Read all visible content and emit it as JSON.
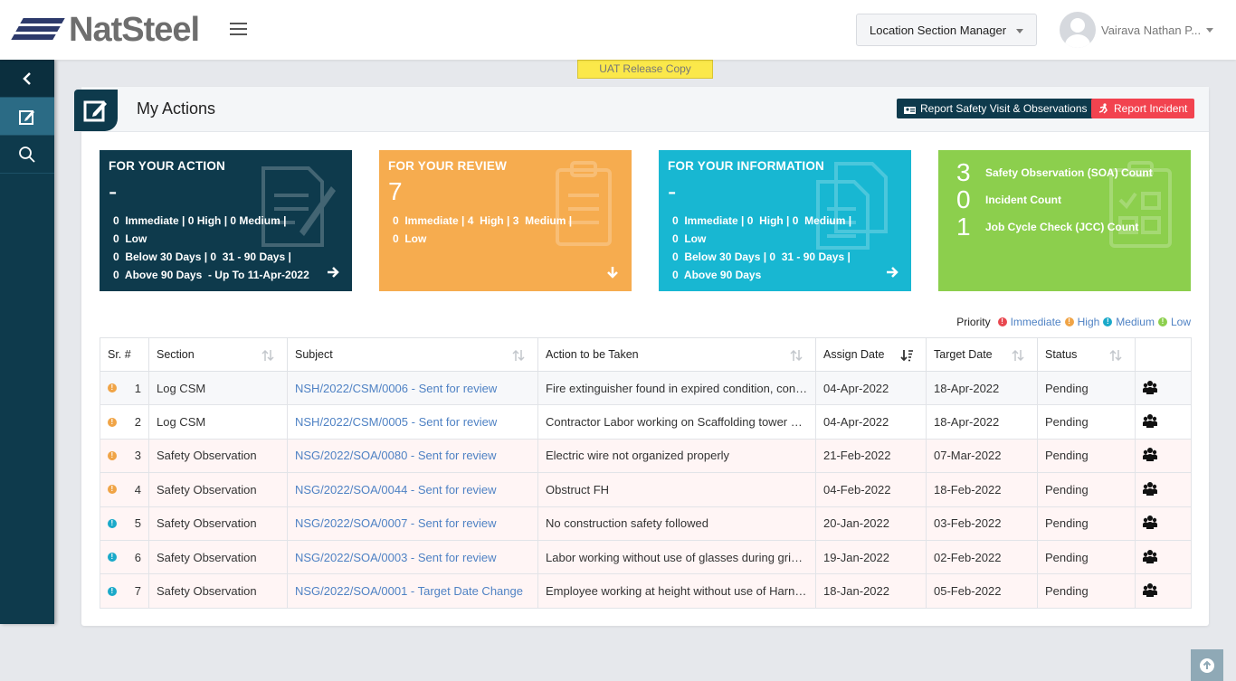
{
  "header": {
    "brand": "NatSteel",
    "role": "Location Section Manager",
    "user_name": "Vairava Nathan P..."
  },
  "banner": "UAT Release Copy",
  "panel": {
    "title": "My Actions",
    "btn_report_visit": "Report Safety Visit & Observations",
    "btn_report_incident": "Report Incident"
  },
  "cards": {
    "action": {
      "title": "FOR YOUR ACTION",
      "big": "-",
      "line1": "0  Immediate | 0 High | 0 Medium |",
      "line2": "0  Low",
      "line3": "0  Below 30 Days | 0  31 - 90 Days |",
      "line4": "0  Above 90 Days  - Up To 11-Apr-2022"
    },
    "review": {
      "title": "FOR YOUR REVIEW",
      "big": "7",
      "line1": "0  Immediate | 4  High | 3  Medium |",
      "line2": "0  Low"
    },
    "info": {
      "title": "FOR YOUR INFORMATION",
      "big": "-",
      "line1": "0  Immediate | 0  High | 0  Medium |",
      "line2": "0  Low",
      "line3": "0  Below 30 Days | 0  31 - 90 Days |",
      "line4": "0  Above 90 Days"
    },
    "counts": [
      {
        "num": "3",
        "label": "Safety Observation (SOA) Count"
      },
      {
        "num": "0",
        "label": "Incident Count"
      },
      {
        "num": "1",
        "label": "Job Cycle Check (JCC) Count"
      }
    ]
  },
  "legend": {
    "label": "Priority",
    "immediate": "Immediate",
    "high": "High",
    "medium": "Medium",
    "low": "Low"
  },
  "colors": {
    "immediate": "#e8474f",
    "high": "#f0a446",
    "medium": "#1aa9c9",
    "low": "#8ccf4d"
  },
  "table": {
    "headers": {
      "sr": "Sr. #",
      "section": "Section",
      "subject": "Subject",
      "action": "Action to be Taken",
      "assign": "Assign Date",
      "target": "Target Date",
      "status": "Status"
    },
    "rows": [
      {
        "sr": "1",
        "section": "Log CSM",
        "subject": "NSH/2022/CSM/0006 - Sent for review",
        "action": "Fire extinguisher found in expired condition, contractor to replace",
        "assign": "04-Apr-2022",
        "target": "18-Apr-2022",
        "status": "Pending"
      },
      {
        "sr": "2",
        "section": "Log CSM",
        "subject": "NSH/2022/CSM/0005 - Sent for review",
        "action": "Contractor Labor working on Scaffolding tower without harness",
        "assign": "04-Apr-2022",
        "target": "18-Apr-2022",
        "status": "Pending"
      },
      {
        "sr": "3",
        "section": "Safety Observation",
        "subject": "NSG/2022/SOA/0080 - Sent for review",
        "action": "Electric wire not organized properly",
        "assign": "21-Feb-2022",
        "target": "07-Mar-2022",
        "status": "Pending"
      },
      {
        "sr": "4",
        "section": "Safety Observation",
        "subject": "NSG/2022/SOA/0044 - Sent for review",
        "action": "Obstruct FH",
        "assign": "04-Feb-2022",
        "target": "18-Feb-2022",
        "status": "Pending"
      },
      {
        "sr": "5",
        "section": "Safety Observation",
        "subject": "NSG/2022/SOA/0007 - Sent for review",
        "action": "No construction safety followed",
        "assign": "20-Jan-2022",
        "target": "03-Feb-2022",
        "status": "Pending"
      },
      {
        "sr": "6",
        "section": "Safety Observation",
        "subject": "NSG/2022/SOA/0003 - Sent for review",
        "action": "Labor working without use of glasses during grinding work",
        "assign": "19-Jan-2022",
        "target": "02-Feb-2022",
        "status": "Pending"
      },
      {
        "sr": "7",
        "section": "Safety Observation",
        "subject": "NSG/2022/SOA/0001 - Target Date Change",
        "action": "Employee working at height without use of Harness belt",
        "assign": "18-Jan-2022",
        "target": "05-Feb-2022",
        "status": "Pending"
      }
    ]
  }
}
